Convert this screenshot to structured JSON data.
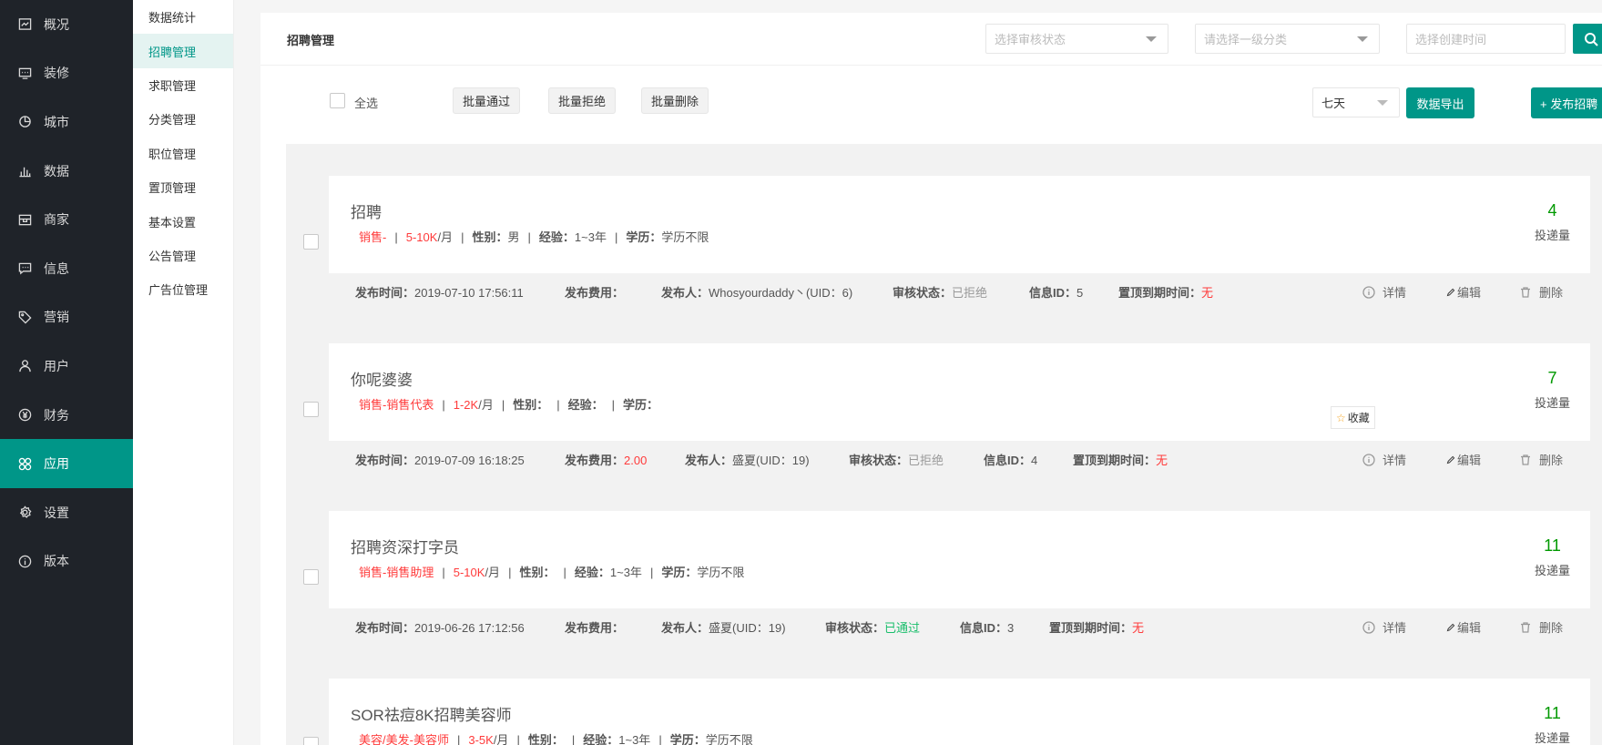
{
  "sidebar": {
    "items": [
      {
        "label": "概况",
        "icon": "overview-icon"
      },
      {
        "label": "装修",
        "icon": "decorate-icon"
      },
      {
        "label": "城市",
        "icon": "city-icon"
      },
      {
        "label": "数据",
        "icon": "chart-icon"
      },
      {
        "label": "商家",
        "icon": "store-icon"
      },
      {
        "label": "信息",
        "icon": "message-icon"
      },
      {
        "label": "营销",
        "icon": "tag-icon"
      },
      {
        "label": "用户",
        "icon": "user-icon"
      },
      {
        "label": "财务",
        "icon": "yen-icon"
      },
      {
        "label": "应用",
        "icon": "apps-icon"
      },
      {
        "label": "设置",
        "icon": "gear-icon"
      },
      {
        "label": "版本",
        "icon": "info-icon"
      }
    ],
    "active_index": 9
  },
  "submenu": {
    "items": [
      "数据统计",
      "招聘管理",
      "求职管理",
      "分类管理",
      "职位管理",
      "置顶管理",
      "基本设置",
      "公告管理",
      "广告位管理"
    ],
    "active_index": 1
  },
  "header": {
    "title": "招聘管理",
    "status_placeholder": "选择审核状态",
    "category_placeholder": "请选择一级分类",
    "date_placeholder": "选择创建时间"
  },
  "toolbar": {
    "select_all": "全选",
    "batch_approve": "批量通过",
    "batch_reject": "批量拒绝",
    "batch_delete": "批量删除",
    "period": "七天",
    "export": "数据导出",
    "publish": "+ 发布招聘"
  },
  "labels": {
    "gender": "性别：",
    "experience": "经验：",
    "education": "学历：",
    "publish_time": "发布时间：",
    "publish_fee": "发布费用：",
    "publisher": "发布人：",
    "review_status": "审核状态：",
    "info_id": "信息ID：",
    "top_expire": "置顶到期时间：",
    "deliveries": "投递量",
    "detail": "详情",
    "edit": "编辑",
    "delete": "删除"
  },
  "favorite_tip": "收藏",
  "listings": [
    {
      "title": "招聘",
      "category": "销售-",
      "salary": "5-10K",
      "salary_unit": "/月",
      "gender": "男",
      "experience": "1~3年",
      "education": "学历不限",
      "count": "4",
      "publish_time": "2019-07-10 17:56:11",
      "fee": "",
      "publisher": "Whosyourdaddy丶(UID：6)",
      "status": "已拒绝",
      "info_id": "5",
      "top_expire": "无"
    },
    {
      "title": "你呢婆婆",
      "category": "销售-销售代表",
      "salary": "1-2K",
      "salary_unit": "/月",
      "gender": "",
      "experience": "",
      "education": "",
      "count": "7",
      "publish_time": "2019-07-09 16:18:25",
      "fee": "2.00",
      "publisher": "盛夏(UID：19)",
      "status": "已拒绝",
      "info_id": "4",
      "top_expire": "无"
    },
    {
      "title": "招聘资深打字员",
      "category": "销售-销售助理",
      "salary": "5-10K",
      "salary_unit": "/月",
      "gender": "",
      "experience": "1~3年",
      "education": "学历不限",
      "count": "11",
      "publish_time": "2019-06-26 17:12:56",
      "fee": "",
      "publisher": "盛夏(UID：19)",
      "status": "已通过",
      "info_id": "3",
      "top_expire": "无"
    },
    {
      "title": "SOR祛痘8K招聘美容师",
      "category": "美容/美发-美容师",
      "salary": "3-5K",
      "salary_unit": "/月",
      "gender": "",
      "experience": "1~3年",
      "education": "学历不限",
      "count": "11"
    }
  ]
}
